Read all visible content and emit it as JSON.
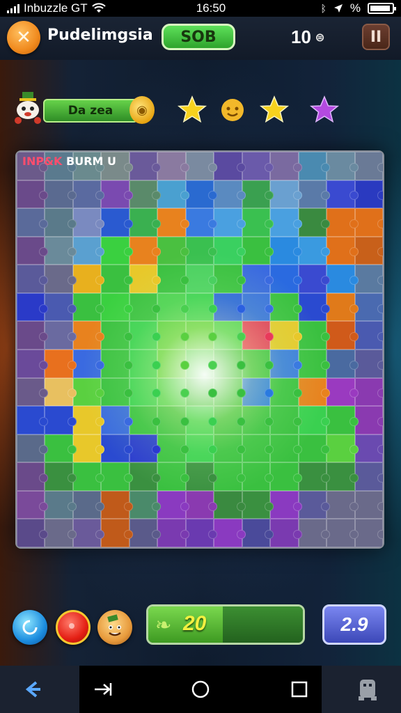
{
  "status_bar": {
    "carrier": "Inbuzzle GT",
    "time": "16:50",
    "battery_symbol": "%"
  },
  "header": {
    "close_icon": "✕",
    "title": "Pudelimgsia",
    "score": "SOB",
    "coins": "10",
    "pause_label": "II"
  },
  "level": {
    "label": "Da zea",
    "stars": [
      {
        "color": "#f7d21e"
      },
      {
        "color": "#f2b82a"
      },
      {
        "color": "#f7d21e"
      },
      {
        "color": "#b44ae0"
      }
    ]
  },
  "board": {
    "label_part1": "INP&K",
    "label_part2": "BURM",
    "label_part3": "U",
    "rows": [
      [
        "#6b5a8a",
        "#5a7a8e",
        "#6a8a8e",
        "#7a8a8a",
        "#6a5a9a",
        "#8a7aa0",
        "#7a8aa0",
        "#5a4aa0",
        "#6a5aaa",
        "#7a6aa0",
        "#4a8ab0",
        "#6a8aa0",
        "#6a7a96"
      ],
      [
        "#6a4a8a",
        "#5a6a90",
        "#5a6aa0",
        "#7a4ab0",
        "#5a8a6a",
        "#4aa0d0",
        "#2a6ad0",
        "#5a8ac0",
        "#3aa050",
        "#6aa0d0",
        "#5a7aa8",
        "#3a4ad0",
        "#2a3ac0"
      ],
      [
        "#5a6a9a",
        "#5a7a8a",
        "#7a8ac0",
        "#2a5ad0",
        "#3ab050",
        "#e8821e",
        "#3a7ae0",
        "#4aa0e0",
        "#3ac050",
        "#4aa0e0",
        "#3a8a40",
        "#e0701a",
        "#e0701a"
      ],
      [
        "#6a4a8a",
        "#6a8a9a",
        "#5aa0d0",
        "#3ad040",
        "#e8821e",
        "#4ac040",
        "#3ac050",
        "#3ad060",
        "#3ac040",
        "#2a8ae0",
        "#3a9ae0",
        "#e0701a",
        "#c8601a"
      ],
      [
        "#5a5a9a",
        "#6a6a8a",
        "#e8b01e",
        "#3ac040",
        "#e8c82a",
        "#3ac040",
        "#4ad060",
        "#3ac040",
        "#3a6ae0",
        "#2a6ae0",
        "#3a4ad0",
        "#2a8ae0",
        "#5a7aa0"
      ],
      [
        "#2a3ac8",
        "#4a5ab0",
        "#3ac040",
        "#3ad040",
        "#3ac040",
        "#4ad050",
        "#3ad050",
        "#2a60e0",
        "#3a70e0",
        "#3ac040",
        "#2a4ad0",
        "#e07a1a",
        "#4a6ab0"
      ],
      [
        "#6a4a8a",
        "#6a6aa0",
        "#e8821e",
        "#3ac040",
        "#3ad050",
        "#5ad040",
        "#5ad040",
        "#4ad050",
        "#e83a5a",
        "#e8c82a",
        "#3ac040",
        "#d05a1a",
        "#4a5ab0"
      ],
      [
        "#6a4a9a",
        "#e8701e",
        "#3a6ae0",
        "#3ac040",
        "#3ad050",
        "#5ad040",
        "#4ad050",
        "#3ac040",
        "#3ac040",
        "#3a7ae0",
        "#3ac040",
        "#4a6aa0",
        "#5a5a9a"
      ],
      [
        "#6a5a8a",
        "#e8c060",
        "#5ad040",
        "#3ac040",
        "#3ad050",
        "#4ad050",
        "#3ac040",
        "#3ac040",
        "#2a7ae0",
        "#3ac040",
        "#e8821e",
        "#9a3ac0",
        "#8a3ab0"
      ],
      [
        "#2a4ad0",
        "#2a4ad0",
        "#e8c82a",
        "#3a6ae0",
        "#3ac040",
        "#3ac040",
        "#3ad050",
        "#3ac040",
        "#3ac040",
        "#3ac040",
        "#3ad050",
        "#3ac040",
        "#8a3ab0"
      ],
      [
        "#5a6a8a",
        "#3ac040",
        "#e8c82a",
        "#2a4ad0",
        "#2a3ad0",
        "#3ac040",
        "#3ad050",
        "#3ac040",
        "#3ac040",
        "#3ac040",
        "#3ac040",
        "#5ad040",
        "#6a4ab0"
      ],
      [
        "#6a4a8a",
        "#3a9040",
        "#3ac040",
        "#3ac040",
        "#3a9040",
        "#3ac040",
        "#3a9040",
        "#3ac040",
        "#3ac040",
        "#3ac040",
        "#3a9040",
        "#3a9040",
        "#5a5a9a"
      ],
      [
        "#7a4a9a",
        "#5a7a8a",
        "#5a6a8a",
        "#c05a1a",
        "#4a8a6a",
        "#8a3ac0",
        "#8a3ab0",
        "#3a8a40",
        "#3a9040",
        "#8a3ac0",
        "#5a5a9a",
        "#6a6a8a",
        "#6a6a8a"
      ],
      [
        "#5a4a8a",
        "#6a6a8a",
        "#6a5a9a",
        "#c05a1a",
        "#5a5a8a",
        "#7a3ab0",
        "#6a3ab0",
        "#8a3ac0",
        "#4a4a9a",
        "#7a3ab0",
        "#6a6a8a",
        "#6a6a8a",
        "#6a6a8a"
      ]
    ]
  },
  "controls": {
    "progress_value": "20",
    "progress_fraction": 0.48,
    "multiplier": "2.9"
  }
}
